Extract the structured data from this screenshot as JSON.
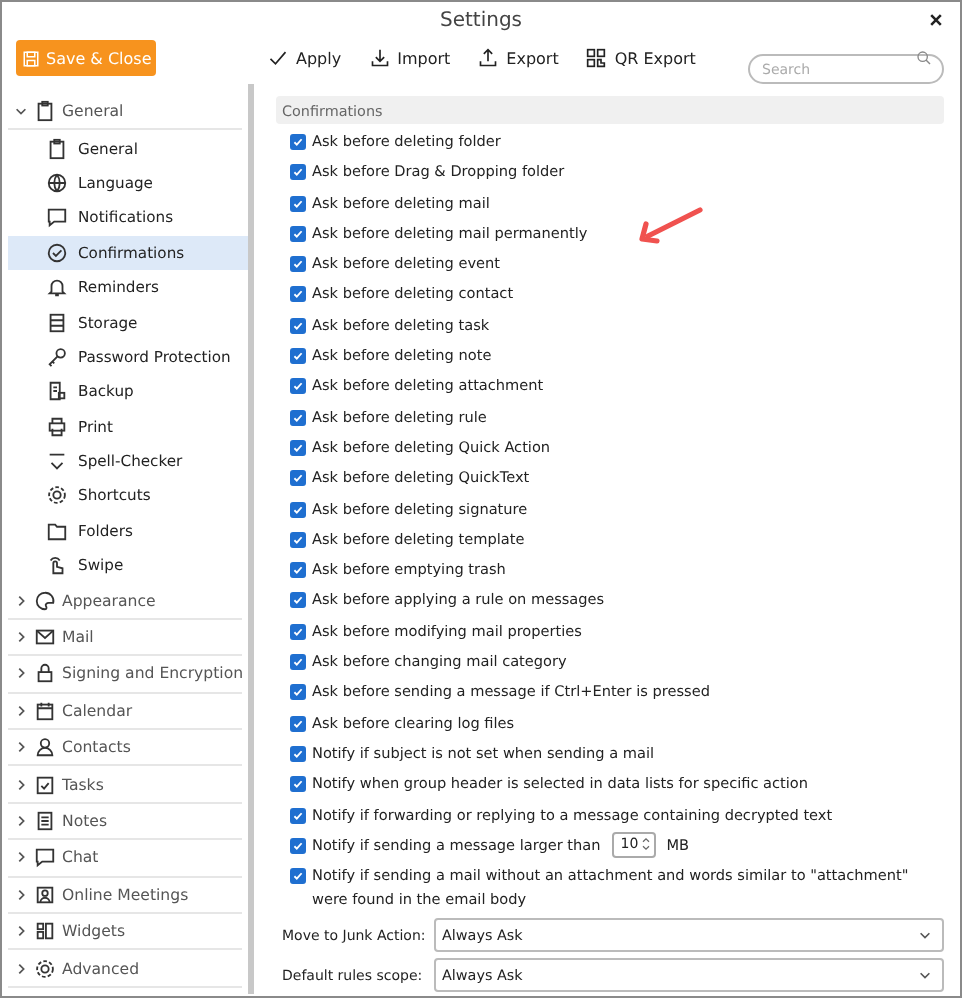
{
  "window": {
    "title": "Settings"
  },
  "toolbar": {
    "save_button": "Save & Close",
    "actions": [
      {
        "label": "Apply"
      },
      {
        "label": "Import"
      },
      {
        "label": "Export"
      },
      {
        "label": "QR Export"
      }
    ],
    "search": {
      "placeholder": "Search"
    }
  },
  "sidebar": {
    "groups": [
      {
        "label": "General",
        "expanded": true,
        "children": [
          {
            "label": "General",
            "selected": false
          },
          {
            "label": "Language",
            "selected": false
          },
          {
            "label": "Notifications",
            "selected": false
          },
          {
            "label": "Confirmations",
            "selected": true
          },
          {
            "label": "Reminders",
            "selected": false
          },
          {
            "label": "Storage",
            "selected": false
          },
          {
            "label": "Password Protection",
            "selected": false
          },
          {
            "label": "Backup",
            "selected": false
          },
          {
            "label": "Print",
            "selected": false
          },
          {
            "label": "Spell-Checker",
            "selected": false
          },
          {
            "label": "Shortcuts",
            "selected": false
          },
          {
            "label": "Folders",
            "selected": false
          },
          {
            "label": "Swipe",
            "selected": false
          }
        ]
      },
      {
        "label": "Appearance",
        "expanded": false
      },
      {
        "label": "Mail",
        "expanded": false
      },
      {
        "label": "Signing and Encryption",
        "expanded": false
      },
      {
        "label": "Calendar",
        "expanded": false
      },
      {
        "label": "Contacts",
        "expanded": false
      },
      {
        "label": "Tasks",
        "expanded": false
      },
      {
        "label": "Notes",
        "expanded": false
      },
      {
        "label": "Chat",
        "expanded": false
      },
      {
        "label": "Online Meetings",
        "expanded": false
      },
      {
        "label": "Widgets",
        "expanded": false
      },
      {
        "label": "Advanced",
        "expanded": false
      }
    ]
  },
  "content": {
    "section_title": "Confirmations",
    "items": [
      {
        "kind": "checkbox",
        "label": "Ask before deleting folder",
        "checked": true
      },
      {
        "kind": "checkbox",
        "label": "Ask before Drag & Dropping folder",
        "checked": true
      },
      {
        "kind": "checkbox",
        "label": "Ask before deleting mail",
        "checked": true
      },
      {
        "kind": "checkbox",
        "label": "Ask before deleting mail permanently",
        "checked": true
      },
      {
        "kind": "checkbox",
        "label": "Ask before deleting event",
        "checked": true
      },
      {
        "kind": "checkbox",
        "label": "Ask before deleting contact",
        "checked": true
      },
      {
        "kind": "checkbox",
        "label": "Ask before deleting task",
        "checked": true
      },
      {
        "kind": "checkbox",
        "label": "Ask before deleting note",
        "checked": true
      },
      {
        "kind": "checkbox",
        "label": "Ask before deleting attachment",
        "checked": true
      },
      {
        "kind": "checkbox",
        "label": "Ask before deleting rule",
        "checked": true
      },
      {
        "kind": "checkbox",
        "label": "Ask before deleting Quick Action",
        "checked": true
      },
      {
        "kind": "checkbox",
        "label": "Ask before deleting QuickText",
        "checked": true
      },
      {
        "kind": "checkbox",
        "label": "Ask before deleting signature",
        "checked": true
      },
      {
        "kind": "checkbox",
        "label": "Ask before deleting template",
        "checked": true
      },
      {
        "kind": "checkbox",
        "label": "Ask before emptying trash",
        "checked": true
      },
      {
        "kind": "checkbox",
        "label": "Ask before applying a rule on messages",
        "checked": true
      },
      {
        "kind": "checkbox",
        "label": "Ask before modifying mail properties",
        "checked": true
      },
      {
        "kind": "checkbox",
        "label": "Ask before changing mail category",
        "checked": true
      },
      {
        "kind": "checkbox",
        "label": "Ask before sending a message if Ctrl+Enter is pressed",
        "checked": true
      },
      {
        "kind": "checkbox",
        "label": "Ask before clearing log files",
        "checked": true
      },
      {
        "kind": "checkbox",
        "label": "Notify if subject is not set when sending a mail",
        "checked": true
      },
      {
        "kind": "checkbox",
        "label": "Notify when group header is selected in data lists for specific action",
        "checked": true
      },
      {
        "kind": "checkbox",
        "label": "Notify if forwarding or replying to a message containing decrypted text",
        "checked": true
      },
      {
        "kind": "number",
        "label": "Notify if sending a message larger than",
        "checked": true,
        "value": "10",
        "unit": "MB"
      },
      {
        "kind": "checkbox",
        "label": "Notify if sending a mail without an attachment and words similar to \"attachment\" were found in the email body",
        "checked": true
      }
    ],
    "dropdowns": [
      {
        "label": "Move to Junk Action:",
        "value": "Always Ask"
      },
      {
        "label": "Default rules scope:",
        "value": "Always Ask"
      }
    ]
  }
}
